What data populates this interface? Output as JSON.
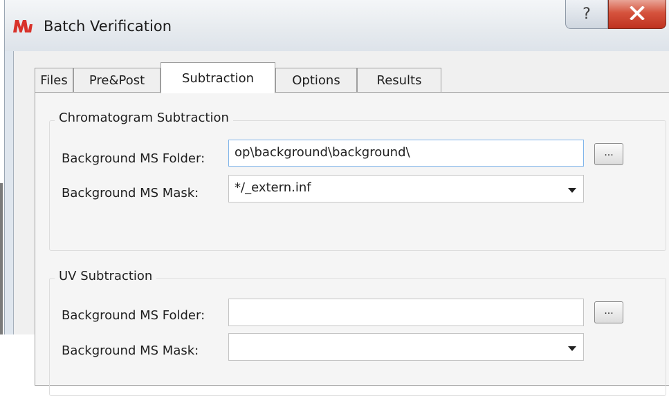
{
  "window": {
    "title": "Batch Verification"
  },
  "title_buttons": {
    "help": "?",
    "close": "✕"
  },
  "tabs": [
    {
      "label": "Files"
    },
    {
      "label": "Pre&Post"
    },
    {
      "label": "Subtraction"
    },
    {
      "label": "Options"
    },
    {
      "label": "Results"
    }
  ],
  "active_tab": "Subtraction",
  "chromatogram_subtraction": {
    "title": "Chromatogram Subtraction",
    "folder_label": "Background MS Folder:",
    "folder_value": "op\\background\\background\\",
    "mask_label": "Background MS Mask:",
    "mask_value": "*/_extern.inf",
    "browse_label": "..."
  },
  "uv_subtraction": {
    "title": "UV Subtraction",
    "folder_label": "Background MS Folder:",
    "folder_value": "",
    "mask_label": "Background MS Mask:",
    "mask_value": "",
    "browse_label": "..."
  }
}
